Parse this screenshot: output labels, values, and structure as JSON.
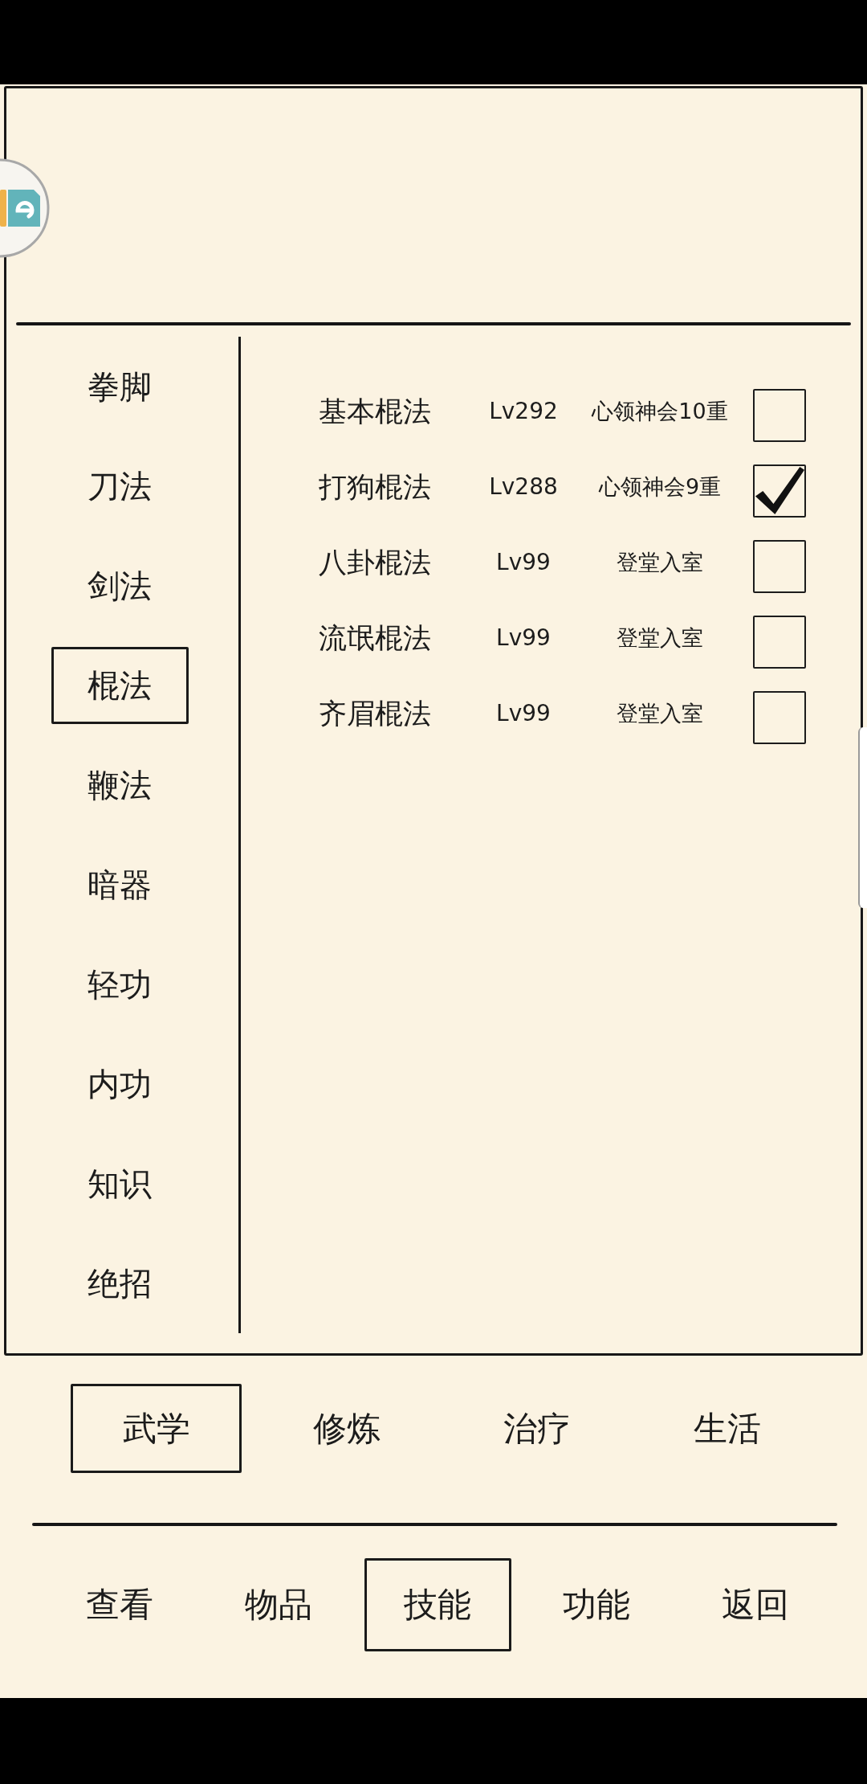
{
  "categories": [
    {
      "label": "拳脚",
      "selected": false
    },
    {
      "label": "刀法",
      "selected": false
    },
    {
      "label": "剑法",
      "selected": false
    },
    {
      "label": "棍法",
      "selected": true
    },
    {
      "label": "鞭法",
      "selected": false
    },
    {
      "label": "暗器",
      "selected": false
    },
    {
      "label": "轻功",
      "selected": false
    },
    {
      "label": "内功",
      "selected": false
    },
    {
      "label": "知识",
      "selected": false
    },
    {
      "label": "绝招",
      "selected": false
    }
  ],
  "skills": [
    {
      "name": "基本棍法",
      "lv": "Lv292",
      "grade": "心领神会10重",
      "checked": false
    },
    {
      "name": "打狗棍法",
      "lv": "Lv288",
      "grade": "心领神会9重",
      "checked": true
    },
    {
      "name": "八卦棍法",
      "lv": "Lv99",
      "grade": "登堂入室",
      "checked": false
    },
    {
      "name": "流氓棍法",
      "lv": "Lv99",
      "grade": "登堂入室",
      "checked": false
    },
    {
      "name": "齐眉棍法",
      "lv": "Lv99",
      "grade": "登堂入室",
      "checked": false
    }
  ],
  "disciplines": [
    {
      "label": "武学",
      "selected": true
    },
    {
      "label": "修炼",
      "selected": false
    },
    {
      "label": "治疗",
      "selected": false
    },
    {
      "label": "生活",
      "selected": false
    }
  ],
  "menu": [
    {
      "label": "查看",
      "selected": false
    },
    {
      "label": "物品",
      "selected": false
    },
    {
      "label": "技能",
      "selected": true
    },
    {
      "label": "功能",
      "selected": false
    },
    {
      "label": "返回",
      "selected": false
    }
  ]
}
